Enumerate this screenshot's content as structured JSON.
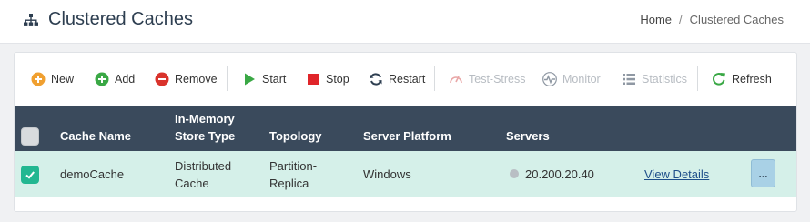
{
  "header": {
    "title": "Clustered Caches",
    "breadcrumb": {
      "home": "Home",
      "separator": "/",
      "current": "Clustered Caches"
    }
  },
  "toolbar": {
    "new": "New",
    "add": "Add",
    "remove": "Remove",
    "start": "Start",
    "stop": "Stop",
    "restart": "Restart",
    "test_stress": "Test-Stress",
    "monitor": "Monitor",
    "statistics": "Statistics",
    "refresh": "Refresh"
  },
  "table": {
    "headers": {
      "cache_name": "Cache Name",
      "store_type_line1": "In-Memory",
      "store_type_line2": "Store Type",
      "topology": "Topology",
      "server_platform": "Server Platform",
      "servers": "Servers"
    },
    "rows": [
      {
        "selected": true,
        "cache_name": "demoCache",
        "store_type_line1": "Distributed",
        "store_type_line2": "Cache",
        "topology_line1": "Partition-",
        "topology_line2": "Replica",
        "server_platform": "Windows",
        "server": "20.200.20.40",
        "details_link": "View Details",
        "more": "..."
      }
    ]
  },
  "colors": {
    "header_bg": "#3a4a5c",
    "row_selected_bg": "#d5f0e9",
    "check_green": "#22b791",
    "icon_new": "#f0a030",
    "icon_add": "#3aa845",
    "icon_remove": "#d9332c",
    "icon_start": "#3aa845",
    "icon_stop": "#e0252a"
  }
}
